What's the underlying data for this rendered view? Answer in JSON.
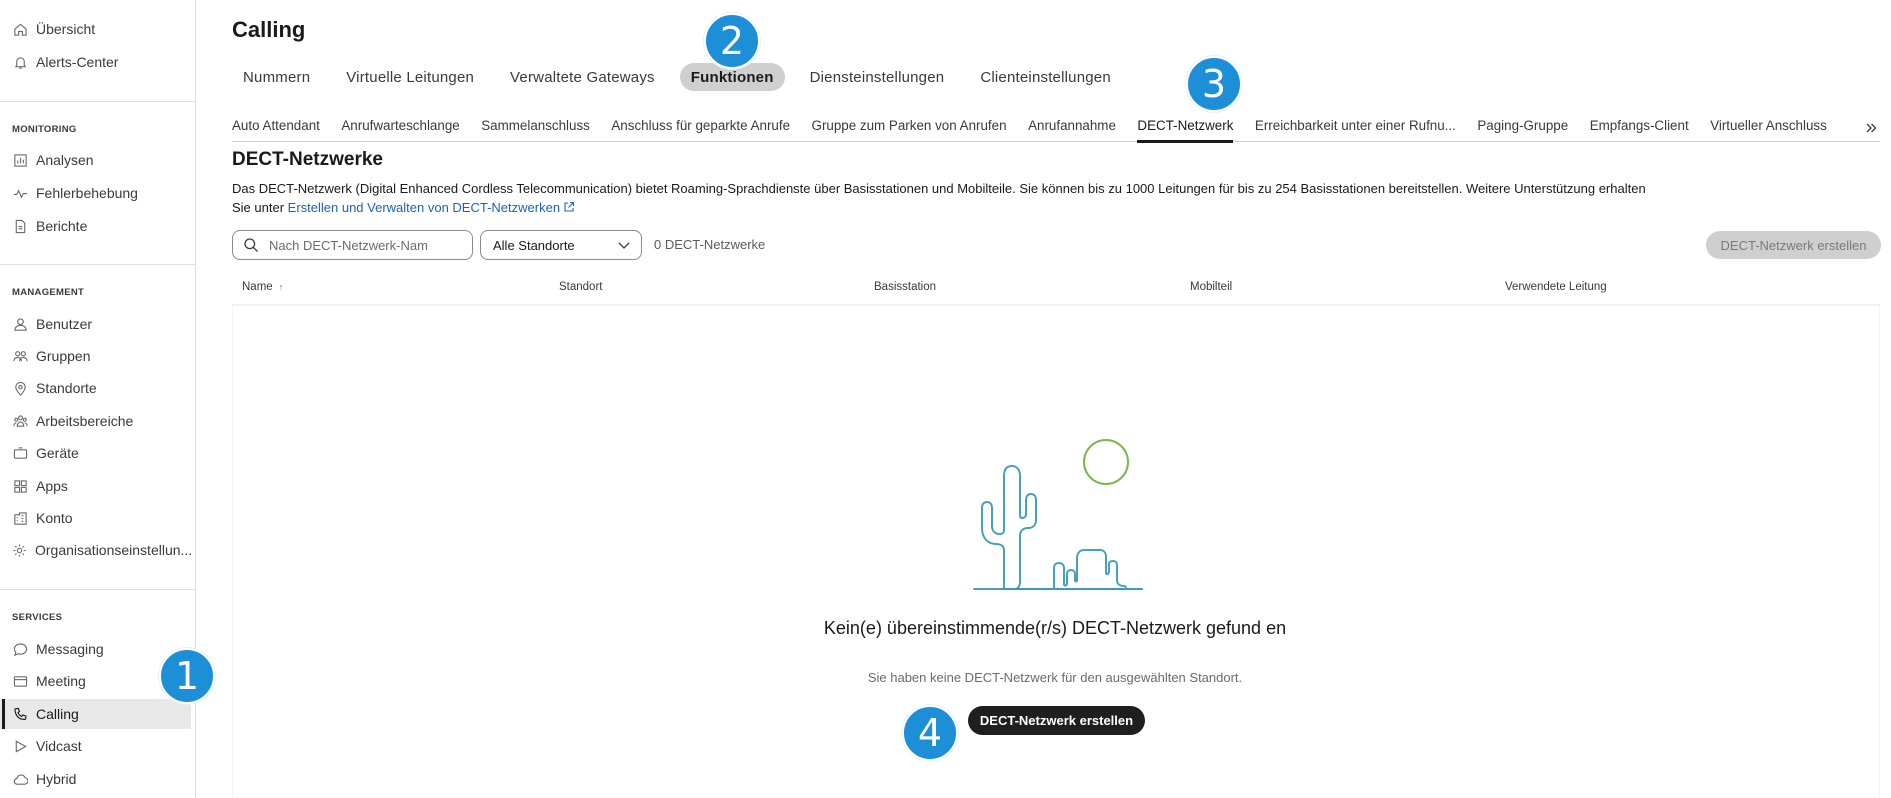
{
  "sidebar": {
    "top_items": [
      {
        "label": "Übersicht",
        "icon": "home-icon"
      },
      {
        "label": "Alerts-Center",
        "icon": "bell-icon"
      }
    ],
    "monitoring_label": "MONITORING",
    "monitoring_items": [
      {
        "label": "Analysen",
        "icon": "analytics-icon"
      },
      {
        "label": "Fehlerbehebung",
        "icon": "pulse-icon"
      },
      {
        "label": "Berichte",
        "icon": "report-icon"
      }
    ],
    "management_label": "MANAGEMENT",
    "management_items": [
      {
        "label": "Benutzer",
        "icon": "user-icon"
      },
      {
        "label": "Gruppen",
        "icon": "group-icon"
      },
      {
        "label": "Standorte",
        "icon": "location-icon"
      },
      {
        "label": "Arbeitsbereiche",
        "icon": "workspaces-icon"
      },
      {
        "label": "Geräte",
        "icon": "device-icon"
      },
      {
        "label": "Apps",
        "icon": "apps-icon"
      },
      {
        "label": "Konto",
        "icon": "account-icon"
      },
      {
        "label": "Organisationseinstellun...",
        "icon": "gear-icon"
      }
    ],
    "services_label": "SERVICES",
    "services_items": [
      {
        "label": "Messaging",
        "icon": "chat-icon"
      },
      {
        "label": "Meeting",
        "icon": "meeting-icon"
      },
      {
        "label": "Calling",
        "icon": "phone-icon",
        "active": true
      },
      {
        "label": "Vidcast",
        "icon": "play-icon"
      },
      {
        "label": "Hybrid",
        "icon": "cloud-icon"
      }
    ]
  },
  "header": {
    "title": "Calling"
  },
  "top_tabs": [
    {
      "label": "Nummern"
    },
    {
      "label": "Virtuelle Leitungen"
    },
    {
      "label": "Verwaltete Gateways"
    },
    {
      "label": "Funktionen",
      "active": true
    },
    {
      "label": "Diensteinstellungen"
    },
    {
      "label": "Clienteinstellungen"
    }
  ],
  "sub_tabs": [
    {
      "label": "Auto Attendant"
    },
    {
      "label": "Anrufwarteschlange"
    },
    {
      "label": "Sammelanschluss"
    },
    {
      "label": "Anschluss für geparkte Anrufe"
    },
    {
      "label": "Gruppe zum Parken von Anrufen"
    },
    {
      "label": "Anrufannahme"
    },
    {
      "label": "DECT-Netzwerk",
      "active": true
    },
    {
      "label": "Erreichbarkeit unter einer Rufnu..."
    },
    {
      "label": "Paging-Gruppe"
    },
    {
      "label": "Empfangs-Client"
    },
    {
      "label": "Virtueller Anschluss"
    }
  ],
  "section": {
    "title": "DECT-Netzwerke",
    "description_line1": "Das DECT-Netzwerk (Digital Enhanced Cordless Telecommunication) bietet Roaming-Sprachdienste über Basisstationen und Mobilteile. Sie können bis zu 1000 Leitungen für bis zu 254 Basisstationen bereitstellen. Weitere Unterstützung erhalten",
    "description_line2_prefix": "Sie unter ",
    "description_link": "Erstellen und Verwalten von DECT-Netzwerken"
  },
  "toolbar": {
    "search_placeholder": "Nach DECT-Netzwerk-Nam",
    "location_select": "Alle Standorte",
    "count_text": "0 DECT-Netzwerke",
    "create_button": "DECT-Netzwerk erstellen"
  },
  "table": {
    "columns": [
      "Name",
      "Standort",
      "Basisstation",
      "Mobilteil",
      "Verwendete Leitung"
    ]
  },
  "empty_state": {
    "title": "Kein(e) übereinstimmende(r/s) DECT-Netzwerk gefund en",
    "subtitle": "Sie haben keine DECT-Netzwerk für den ausgewählten Standort.",
    "button": "DECT-Netzwerk erstellen"
  },
  "callouts": [
    "1",
    "2",
    "3",
    "4"
  ],
  "colors": {
    "callout": "#1d8fd6",
    "link": "#1d63b3",
    "cactus": "#4aa0b8",
    "sun": "#7ab648"
  }
}
